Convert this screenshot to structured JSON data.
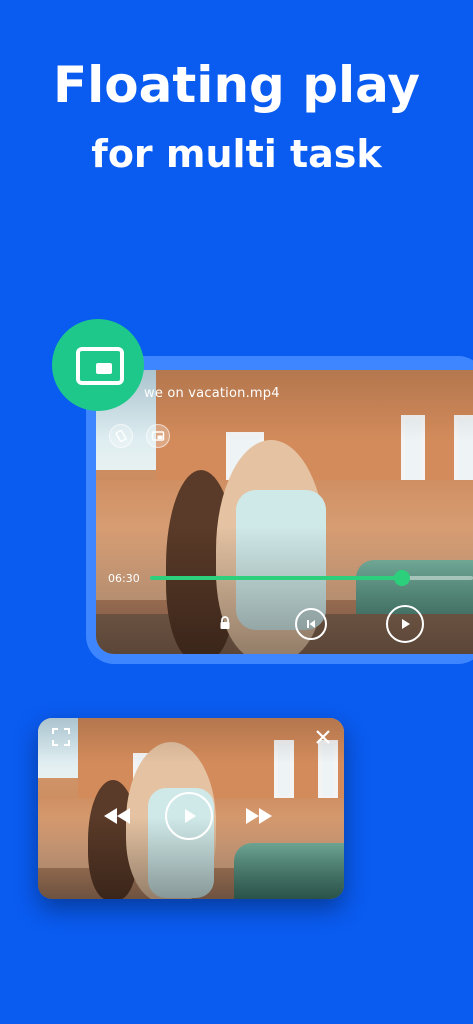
{
  "headline": {
    "line1": "Floating play",
    "line2": "for multi task"
  },
  "player": {
    "file_name": "we on vacation.mp4",
    "current_time": "06:30",
    "progress": 0.78
  },
  "colors": {
    "background": "#0a5bf0",
    "accent": "#2ccf7b",
    "badge": "#1ec88a"
  },
  "icons": {
    "pip_badge": "picture-in-picture-icon",
    "rotate": "screen-rotation-icon",
    "pip_small": "picture-in-picture-small-icon",
    "lock": "lock-icon",
    "previous": "skip-previous-icon",
    "play": "play-icon",
    "fullscreen": "fullscreen-icon",
    "close": "close-icon",
    "rewind": "rewind-icon",
    "fast_forward": "fast-forward-icon"
  }
}
